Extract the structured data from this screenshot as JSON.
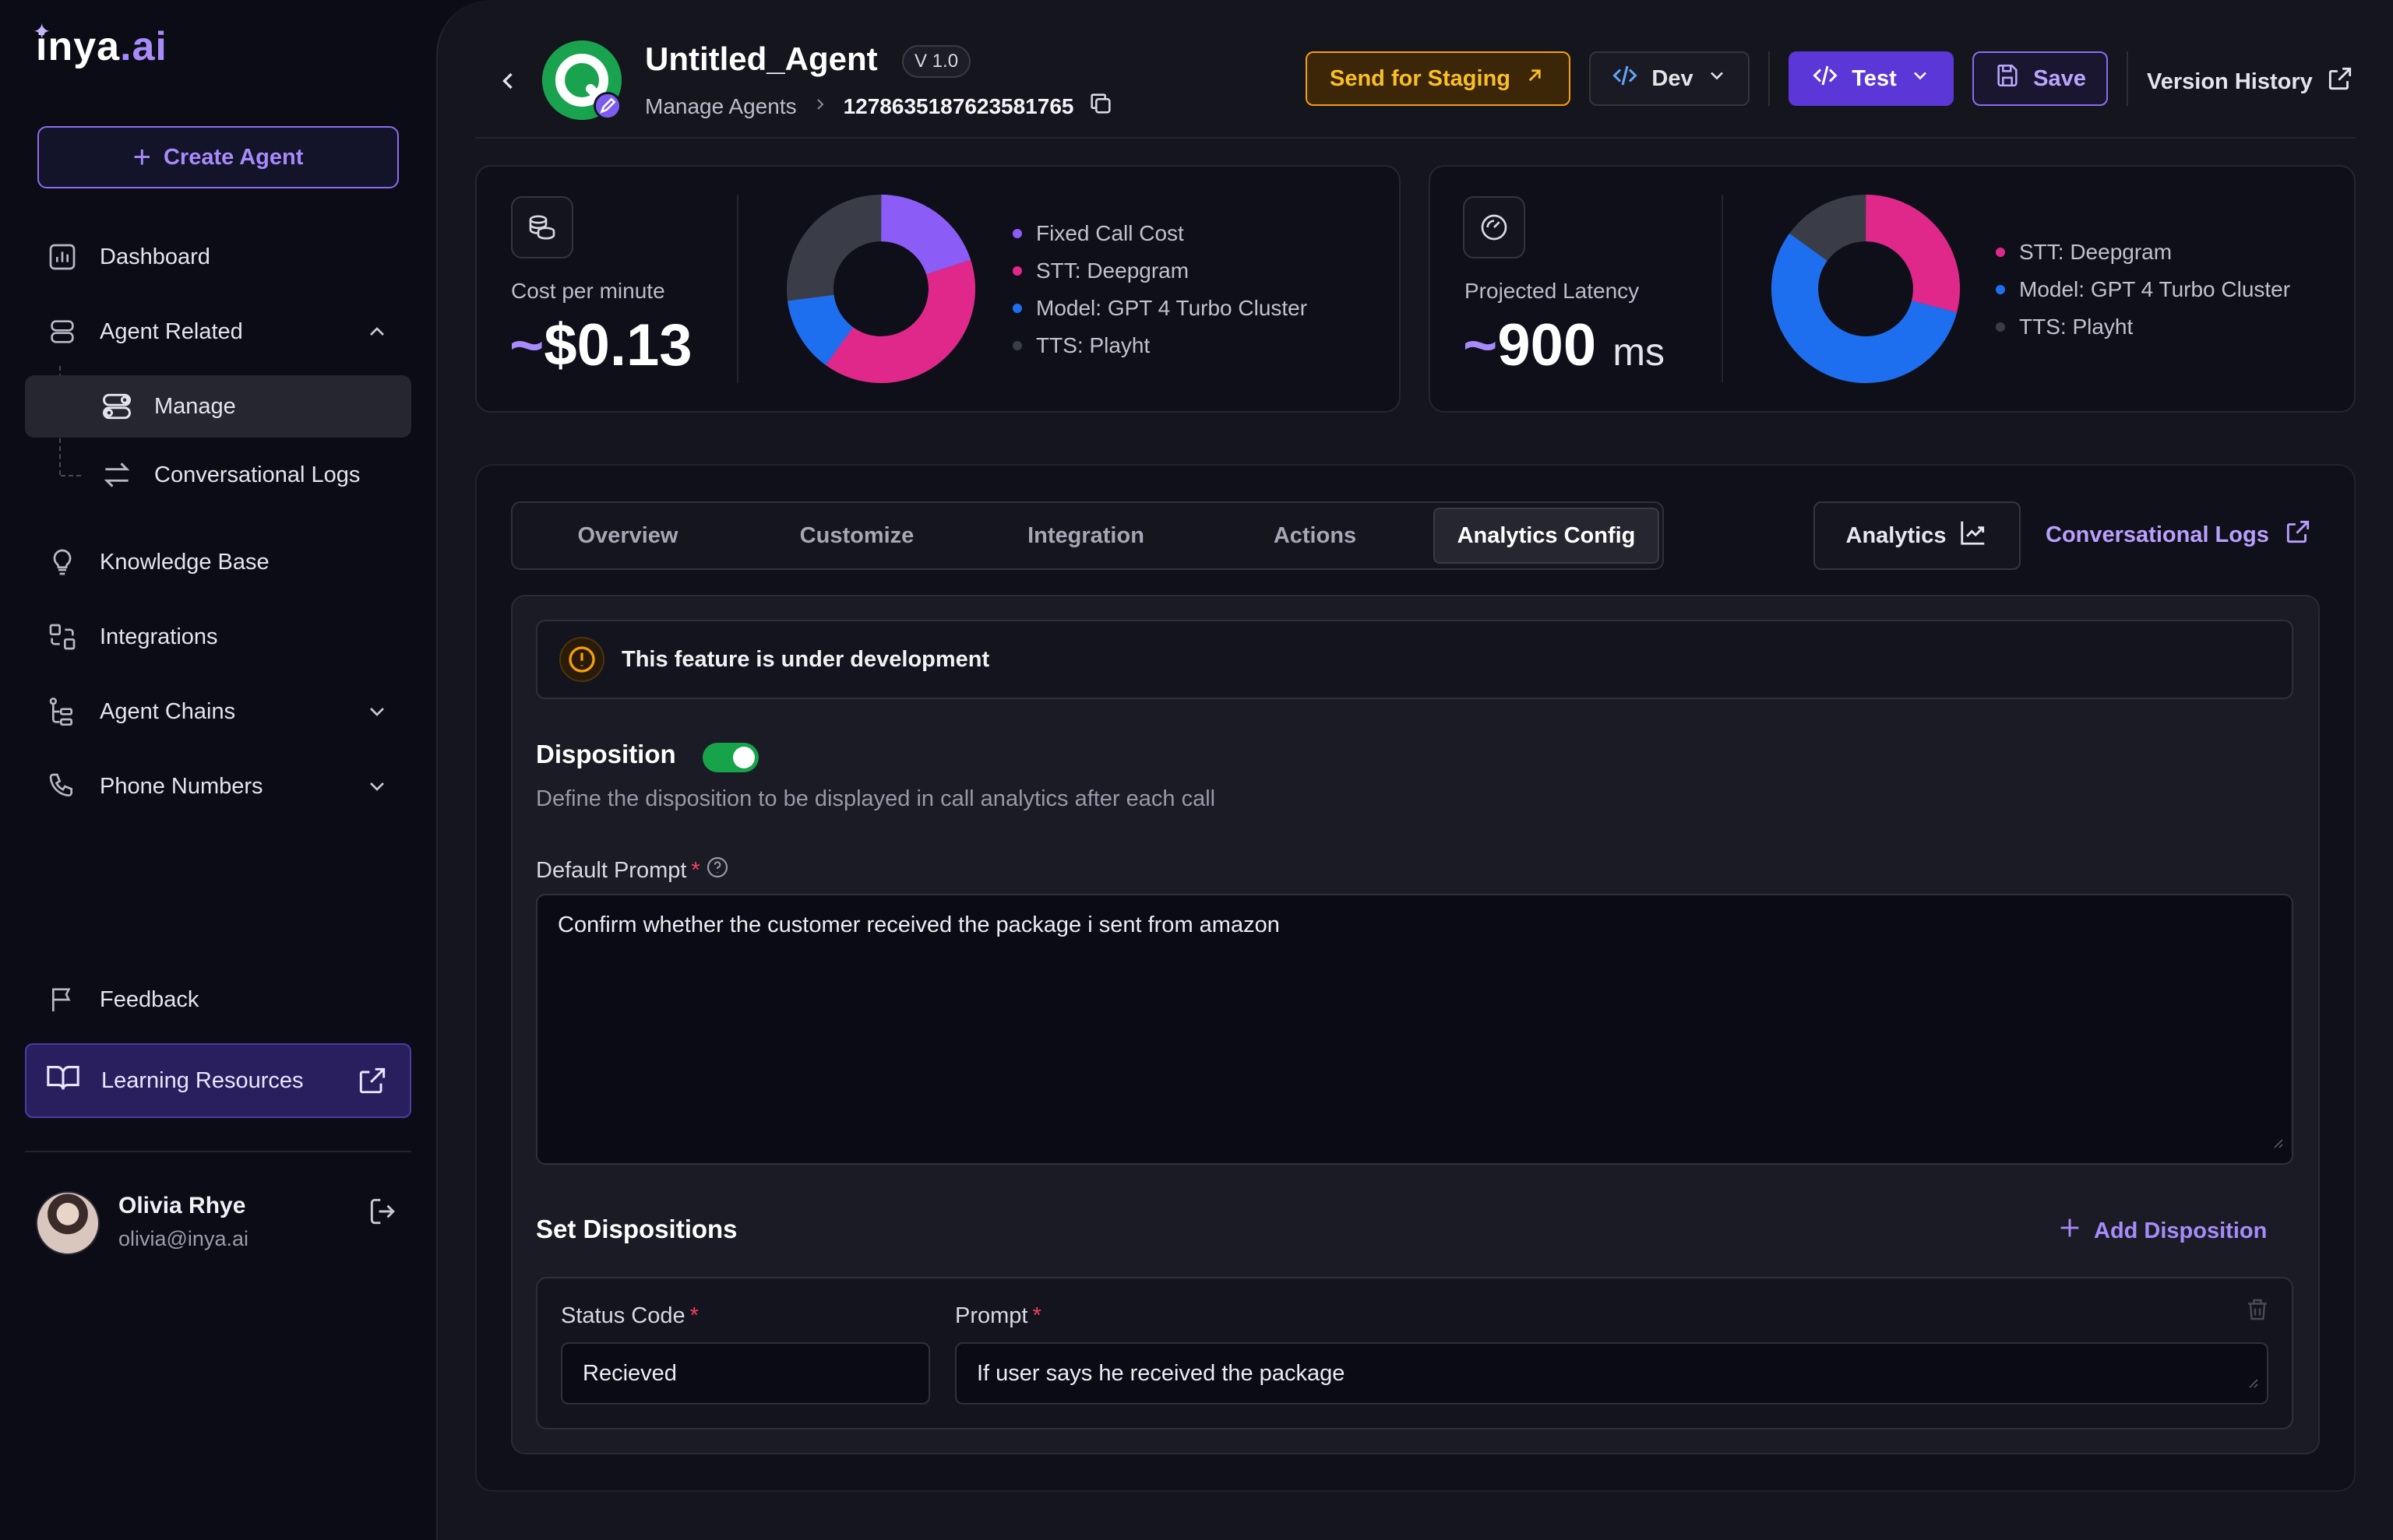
{
  "brand": {
    "logo_main": "inya",
    "logo_dot": ".ai"
  },
  "sidebar": {
    "create_agent": "Create Agent",
    "items": {
      "dashboard": "Dashboard",
      "agent_related": "Agent Related",
      "manage": "Manage",
      "conversational_logs": "Conversational Logs",
      "knowledge_base": "Knowledge Base",
      "integrations": "Integrations",
      "agent_chains": "Agent Chains",
      "phone_numbers": "Phone Numbers",
      "feedback": "Feedback",
      "learning_resources": "Learning Resources"
    },
    "user": {
      "name": "Olivia Rhye",
      "email": "olivia@inya.ai"
    }
  },
  "header": {
    "agent_name": "Untitled_Agent",
    "version": "V 1.0",
    "breadcrumb_parent": "Manage Agents",
    "agent_id": "1278635187623581765",
    "send_staging": "Send for Staging",
    "env": "Dev",
    "test": "Test",
    "save": "Save",
    "version_history": "Version History"
  },
  "cost_card": {
    "label": "Cost per minute",
    "tilde": "~",
    "value": "$0.13",
    "legend": [
      "Fixed Call Cost",
      "STT: Deepgram",
      "Model: GPT 4 Turbo Cluster",
      "TTS: Playht"
    ],
    "legend_colors": [
      "#8b5cf6",
      "#e0288a",
      "#1e6ff0",
      "#3a3d48"
    ]
  },
  "latency_card": {
    "label": "Projected Latency",
    "tilde": "~",
    "value": "900",
    "unit": "ms",
    "legend": [
      "STT: Deepgram",
      "Model: GPT 4 Turbo Cluster",
      "TTS: Playht"
    ],
    "legend_colors": [
      "#e0288a",
      "#1e6ff0",
      "#3a3d48"
    ]
  },
  "tabs": [
    "Overview",
    "Customize",
    "Integration",
    "Actions",
    "Analytics Config"
  ],
  "active_tab": "Analytics Config",
  "analytics_button": "Analytics",
  "conversational_logs_link": "Conversational Logs",
  "notice": "This feature is under development",
  "disposition": {
    "title": "Disposition",
    "enabled": true,
    "description": "Define the disposition to be displayed in call analytics after each call",
    "default_prompt_label": "Default Prompt",
    "required_mark": "*",
    "default_prompt_value": "Confirm whether the customer received the package i sent from amazon"
  },
  "set_dispositions": {
    "title": "Set Dispositions",
    "add_label": "Add Disposition",
    "status_code_label": "Status Code",
    "prompt_label": "Prompt",
    "rows": [
      {
        "status_code": "Recieved",
        "prompt": "If user says he received the package"
      }
    ]
  }
}
